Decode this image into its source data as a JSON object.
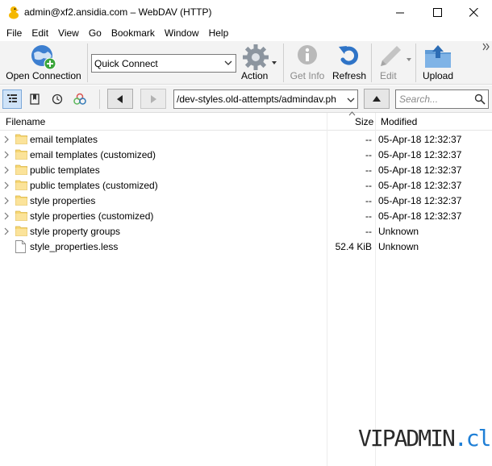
{
  "window": {
    "title": "admin@xf2.ansidia.com – WebDAV (HTTP)"
  },
  "menu": [
    "File",
    "Edit",
    "View",
    "Go",
    "Bookmark",
    "Window",
    "Help"
  ],
  "toolbar": {
    "open_connection": "Open Connection",
    "quick_connect": "Quick Connect",
    "action": "Action",
    "get_info": "Get Info",
    "refresh": "Refresh",
    "edit": "Edit",
    "upload": "Upload"
  },
  "navigation": {
    "path": "/dev-styles.old-attempts/admindav.ph",
    "search_placeholder": "Search..."
  },
  "columns": {
    "filename": "Filename",
    "size": "Size",
    "modified": "Modified"
  },
  "files": [
    {
      "name": "email templates",
      "size": "--",
      "modified": "05-Apr-18 12:32:37",
      "type": "folder"
    },
    {
      "name": "email templates (customized)",
      "size": "--",
      "modified": "05-Apr-18 12:32:37",
      "type": "folder"
    },
    {
      "name": "public templates",
      "size": "--",
      "modified": "05-Apr-18 12:32:37",
      "type": "folder"
    },
    {
      "name": "public templates (customized)",
      "size": "--",
      "modified": "05-Apr-18 12:32:37",
      "type": "folder"
    },
    {
      "name": "style properties",
      "size": "--",
      "modified": "05-Apr-18 12:32:37",
      "type": "folder"
    },
    {
      "name": "style properties (customized)",
      "size": "--",
      "modified": "05-Apr-18 12:32:37",
      "type": "folder"
    },
    {
      "name": "style property groups",
      "size": "--",
      "modified": "Unknown",
      "type": "folder"
    },
    {
      "name": "style_properties.less",
      "size": "52.4 KiB",
      "modified": "Unknown",
      "type": "file"
    }
  ],
  "watermark": {
    "part1": "VIPADMIN",
    "part2": ".club"
  }
}
